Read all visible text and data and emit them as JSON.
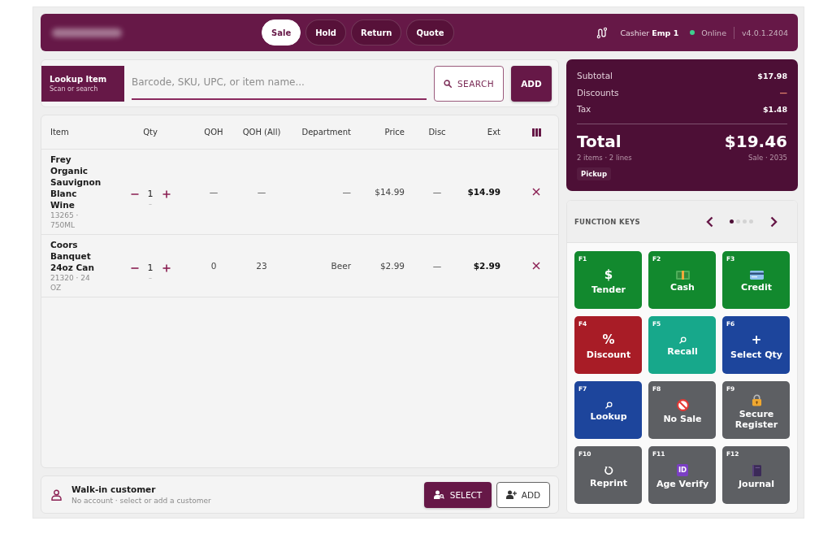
{
  "header": {
    "tabs": [
      {
        "label": "Sale",
        "selected": true
      },
      {
        "label": "Hold",
        "selected": false
      },
      {
        "label": "Return",
        "selected": false
      },
      {
        "label": "Quote",
        "selected": false
      }
    ],
    "cashier": "Cashier **Emp 1**",
    "status": {
      "label": "Online",
      "online": true
    },
    "version": "v4.0.1.2404"
  },
  "lookup": {
    "title": "Lookup Item",
    "subtitle": "Scan or search",
    "placeholder": "Barcode, SKU, UPC, or item name...",
    "search_button": "SEARCH",
    "add_button": "ADD"
  },
  "table": {
    "columns": [
      "Item",
      "Qty",
      "QOH",
      "QOH (All)",
      "Department",
      "Price",
      "Disc",
      "Ext"
    ],
    "rows": [
      {
        "name": "Frey Organic Sauvignon Blanc Wine",
        "detail": "13265 · 750ML",
        "qty": "1",
        "qty_note": "–",
        "qoh": "—",
        "qoh_all": "—",
        "department": "—",
        "price": "$14.99",
        "disc": "—",
        "ext": "$14.99"
      },
      {
        "name": "Coors Banquet 24oz Can",
        "detail": "21320 · 24 OZ",
        "qty": "1",
        "qty_note": "–",
        "qoh": "0",
        "qoh_all": "23",
        "department": "Beer",
        "price": "$2.99",
        "disc": "—",
        "ext": "$2.99"
      }
    ]
  },
  "customer": {
    "name": "Walk-in customer",
    "note": "No account · select or add a customer",
    "select_button": "SELECT",
    "add_button": "ADD"
  },
  "totals": {
    "lines": [
      {
        "kind": "amount",
        "label": "Subtotal",
        "value": "$17.98"
      },
      {
        "kind": "discount",
        "label": "Discounts",
        "value": "—"
      },
      {
        "kind": "amount",
        "label": "Tax",
        "value": "$1.48"
      }
    ],
    "total_label": "Total",
    "total_value": "$19.46",
    "summary": "2 items · 2 lines",
    "reference": "Sale · 2035",
    "badge": "Pickup"
  },
  "function_keys": {
    "title": "FUNCTION KEYS",
    "pages": [
      {
        "selected": true
      },
      {
        "selected": false
      },
      {
        "selected": false
      },
      {
        "selected": false
      }
    ],
    "keys": [
      {
        "key": "F1",
        "label": "Tender",
        "symbol": "$",
        "color": "#12892e"
      },
      {
        "key": "F2",
        "label": "Cash",
        "color": "#12892e"
      },
      {
        "key": "F3",
        "label": "Credit",
        "color": "#12892e"
      },
      {
        "key": "F4",
        "label": "Discount",
        "symbol": "%",
        "color": "#a81c26"
      },
      {
        "key": "F5",
        "label": "Recall",
        "color": "#17a88b"
      },
      {
        "key": "F6",
        "label": "Select Qty",
        "symbol": "+",
        "color": "#1d459c"
      },
      {
        "key": "F7",
        "label": "Lookup",
        "color": "#1d459c"
      },
      {
        "key": "F8",
        "label": "No Sale",
        "color": "#5d5f63"
      },
      {
        "key": "F9",
        "label": "Secure Register",
        "color": "#5d5f63"
      },
      {
        "key": "F10",
        "label": "Reprint",
        "color": "#5d5f63"
      },
      {
        "key": "F11",
        "label": "Age Verify",
        "badge": "ID",
        "color": "#5d5f63"
      },
      {
        "key": "F12",
        "label": "Journal",
        "color": "#5d5f63"
      }
    ]
  }
}
